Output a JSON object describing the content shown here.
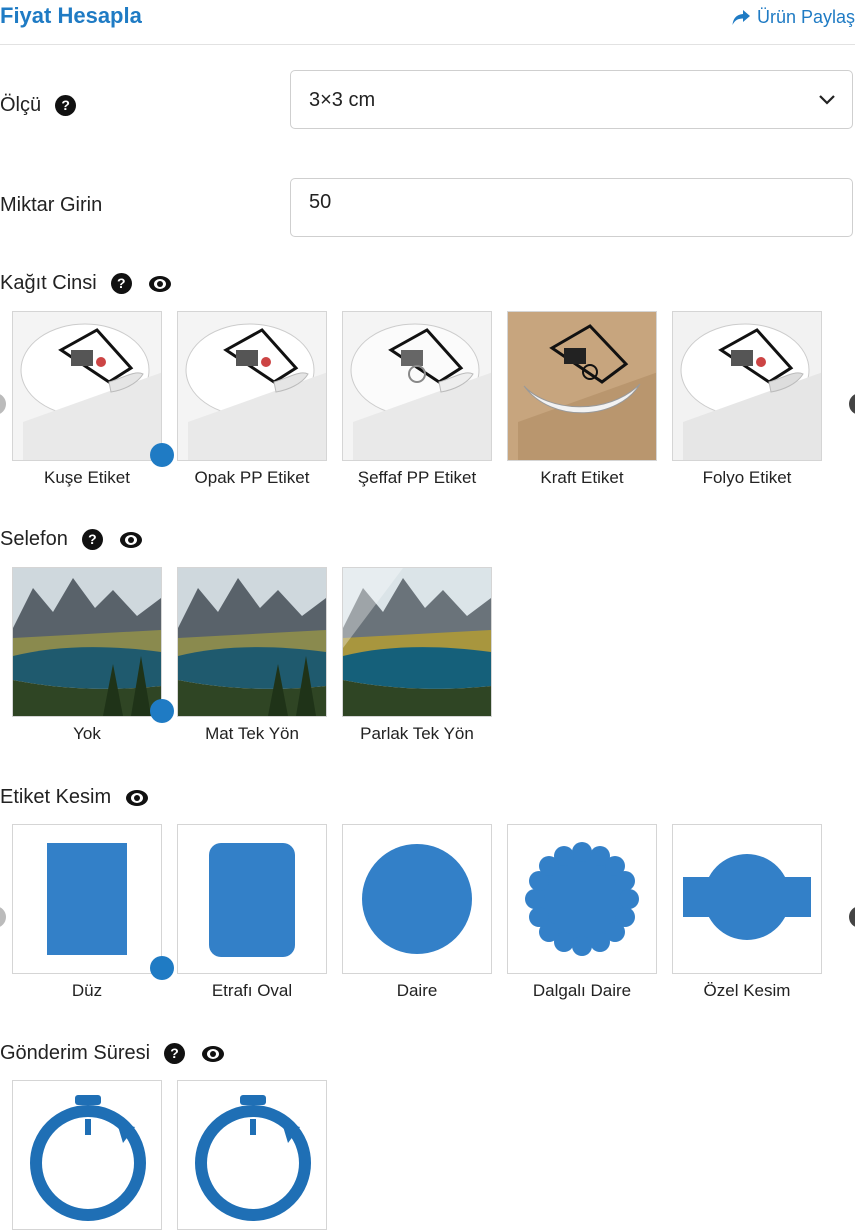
{
  "header": {
    "title": "Fiyat Hesapla",
    "share_label": "Ürün Paylaş"
  },
  "size": {
    "label": "Ölçü",
    "value": "3×3 cm"
  },
  "quantity": {
    "label": "Miktar Girin",
    "value": "50"
  },
  "paper": {
    "label": "Kağıt Cinsi",
    "options": [
      "Kuşe Etiket",
      "Opak PP Etiket",
      "Şeffaf PP Etiket",
      "Kraft Etiket",
      "Folyo Etiket"
    ],
    "selected": "Kuşe Etiket"
  },
  "laminate": {
    "label": "Selefon",
    "options": [
      "Yok",
      "Mat Tek Yön",
      "Parlak Tek Yön"
    ],
    "selected": "Yok"
  },
  "cut": {
    "label": "Etiket Kesim",
    "options": [
      "Düz",
      "Etrafı Oval",
      "Daire",
      "Dalgalı Daire",
      "Özel Kesim"
    ],
    "selected": "Düz"
  },
  "shipping": {
    "label": "Gönderim Süresi"
  },
  "colors": {
    "accent": "#1f7bc4",
    "shape": "#3380c8"
  }
}
